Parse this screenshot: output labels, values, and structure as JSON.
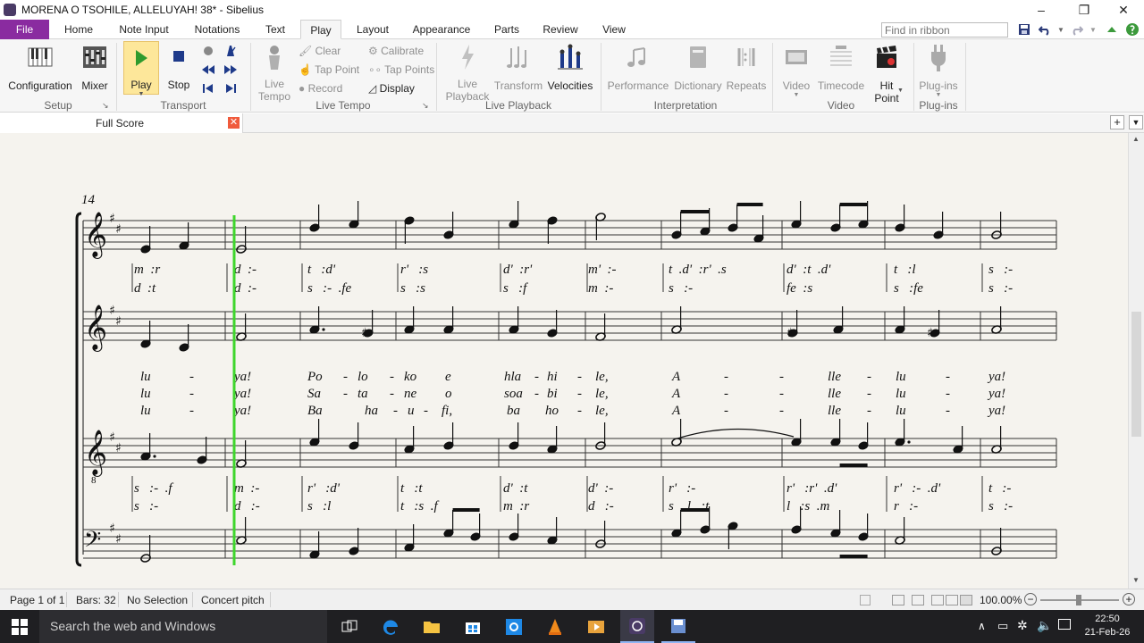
{
  "window": {
    "title": "MORENA O TSOHILE, ALLELUYAH! 38* - Sibelius",
    "controls": [
      "–",
      "❐",
      "✕"
    ]
  },
  "ribbon_tabs": [
    {
      "label": "File"
    },
    {
      "label": "Home"
    },
    {
      "label": "Note Input"
    },
    {
      "label": "Notations"
    },
    {
      "label": "Text"
    },
    {
      "label": "Play"
    },
    {
      "label": "Layout"
    },
    {
      "label": "Appearance"
    },
    {
      "label": "Parts"
    },
    {
      "label": "Review"
    },
    {
      "label": "View"
    }
  ],
  "ribbon_search": {
    "placeholder": "Find in ribbon"
  },
  "ribbon": {
    "setup": {
      "group": "Setup",
      "configuration": "Configuration",
      "mixer": "Mixer"
    },
    "transport": {
      "group": "Transport",
      "play": "Play",
      "stop": "Stop"
    },
    "live_tempo": {
      "group": "Live Tempo",
      "live_tempo_line1": "Live",
      "live_tempo_line2": "Tempo",
      "clear": "Clear",
      "tap_point": "Tap Point",
      "record": "Record",
      "calibrate": "Calibrate",
      "tap_points": "Tap Points",
      "display": "Display"
    },
    "live_playback": {
      "group": "Live Playback",
      "live_playback_line1": "Live",
      "live_playback_line2": "Playback",
      "transform": "Transform",
      "velocities": "Velocities"
    },
    "interpretation": {
      "group": "Interpretation",
      "performance": "Performance",
      "dictionary": "Dictionary",
      "repeats": "Repeats"
    },
    "video": {
      "group": "Video",
      "video": "Video",
      "timecode": "Timecode",
      "hit_point_line1": "Hit",
      "hit_point_line2": "Point"
    },
    "plugins": {
      "group": "Plug-ins",
      "plugins": "Plug-ins"
    }
  },
  "document_tab": {
    "label": "Full Score"
  },
  "score": {
    "bar_number": "14",
    "sol_fa_s1": [
      "m  :r",
      "d  :-",
      "t   :d'",
      "r'   :s",
      "d'  :r'",
      "m'  :-",
      "t  .d'  :r'  .s",
      "d'  :t  .d'",
      "t   :l",
      "s   :-"
    ],
    "sol_fa_a1": [
      "d  :t",
      "d  :-",
      "s   :-  .fe",
      "s   :s",
      "s   :f",
      "m  :-",
      "s   :-",
      "fe  :s",
      "s   :fe",
      "s   :-"
    ],
    "lyrics_v1": [
      "lu",
      "-",
      "ya!",
      "Po",
      "-",
      "lo",
      "-",
      "ko",
      "e",
      "hla",
      "-",
      "hi",
      "-",
      "le,",
      "A",
      "-",
      "-",
      "lle",
      "-",
      "lu",
      "-",
      "ya!"
    ],
    "lyrics_v2": [
      "lu",
      "-",
      "ya!",
      "Sa",
      "-",
      "ta",
      "-",
      "ne",
      "o",
      "soa",
      "-",
      "bi",
      "-",
      "le,",
      "A",
      "-",
      "-",
      "lle",
      "-",
      "lu",
      "-",
      "ya!"
    ],
    "lyrics_v3": [
      "lu",
      "-",
      "ya!",
      "Ba",
      "ha",
      "-",
      "u",
      "-",
      "fi,",
      "ba",
      "ho",
      "-",
      "le,",
      "A",
      "-",
      "-",
      "lle",
      "-",
      "lu",
      "-",
      "ya!"
    ],
    "sol_fa_t": [
      "s   :-  .f",
      "m  :-",
      "r'   :d'",
      "t   :t",
      "d'  :t",
      "d'  :-",
      "r'   :-",
      "r'   :r'  .d'",
      "r'   :-  .d'",
      "t   :-"
    ],
    "sol_fa_b": [
      "s   :-",
      "d   :-",
      "s   :l",
      "t   :s  .f",
      "m  :r",
      "d   :-",
      "s   .l   :t",
      "l   :s  .m",
      "r   :-",
      "s   :-"
    ]
  },
  "status": {
    "page": "Page 1 of 1",
    "bars": "Bars: 32",
    "selection": "No Selection",
    "pitch": "Concert pitch",
    "zoom": "100.00%"
  },
  "taskbar": {
    "search_placeholder": "Search the web and Windows",
    "time": "22:50",
    "date": "21-Feb-26"
  }
}
